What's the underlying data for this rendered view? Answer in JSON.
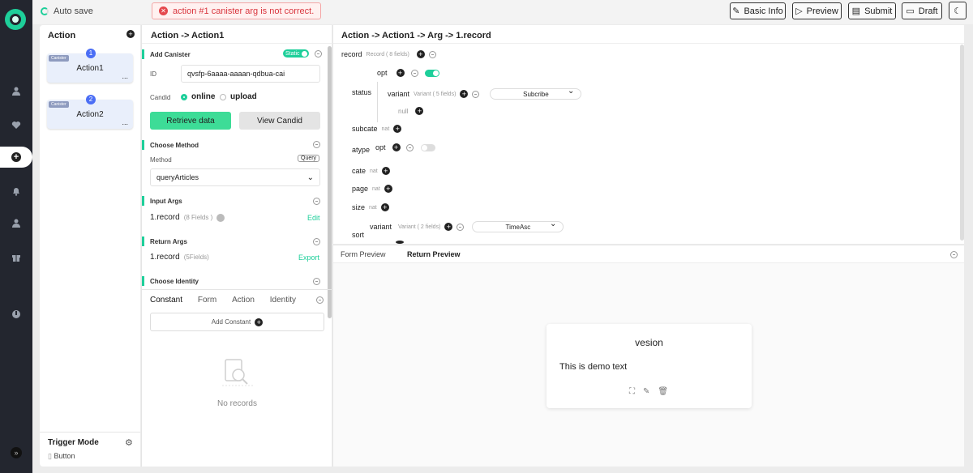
{
  "topbar": {
    "autosave_label": "Auto save",
    "alert_text": "action #1 canister arg is not correct.",
    "buttons": {
      "basic_info": "Basic Info",
      "preview": "Preview",
      "submit": "Submit",
      "draft": "Draft"
    }
  },
  "actions_panel": {
    "title": "Action",
    "cards": [
      {
        "tag": "Canister",
        "num": "1",
        "name": "Action1",
        "more": "..."
      },
      {
        "tag": "Canister",
        "num": "2",
        "name": "Action2",
        "more": "..."
      }
    ],
    "trigger_title": "Trigger Mode",
    "trigger_value": "Button"
  },
  "config": {
    "title": "Action -> Action1",
    "add_canister": "Add Canister",
    "static_label": "Static",
    "id_label": "ID",
    "id_value": "qvsfp-6aaaa-aaaan-qdbua-cai",
    "candid_label": "Candid",
    "candid_online": "online",
    "candid_upload": "upload",
    "retrieve_btn": "Retrieve data",
    "view_btn": "View Candid",
    "choose_method": "Choose Method",
    "method_label": "Method",
    "method_badge": "Query",
    "method_value": "queryArticles",
    "input_args": "Input Args",
    "input_record": "1.record",
    "input_fields": "(8 Fields )",
    "edit_link": "Edit",
    "return_args": "Return Args",
    "return_record": "1.record",
    "return_fields": "(5Fields)",
    "export_link": "Export",
    "choose_identity": "Choose Identity",
    "tabs": [
      "Constant",
      "Form",
      "Action",
      "Identity"
    ],
    "add_constant": "Add Constant",
    "no_records": "No records"
  },
  "editor": {
    "breadcrumb": "Action -> Action1 -> Arg -> 1.record",
    "record_key": "record",
    "record_type": "Record ( 8 fields)",
    "opt1": "opt",
    "status_key": "status",
    "variant1": "variant",
    "variant1_type": "Variant ( 5 fields)",
    "variant1_select": "Subcribe",
    "null_label": "null",
    "subcate_key": "subcate",
    "nat": "nat",
    "atype_key": "atype",
    "opt2": "opt",
    "cate_key": "cate",
    "page_key": "page",
    "size_key": "size",
    "sort_key": "sort",
    "variant2": "variant",
    "variant2_type": "Variant ( 2 fields)",
    "variant2_select": "TimeAsc"
  },
  "preview": {
    "tabs": [
      "Form Preview",
      "Return Preview"
    ],
    "card_title": "vesion",
    "card_text": "This is demo text"
  }
}
